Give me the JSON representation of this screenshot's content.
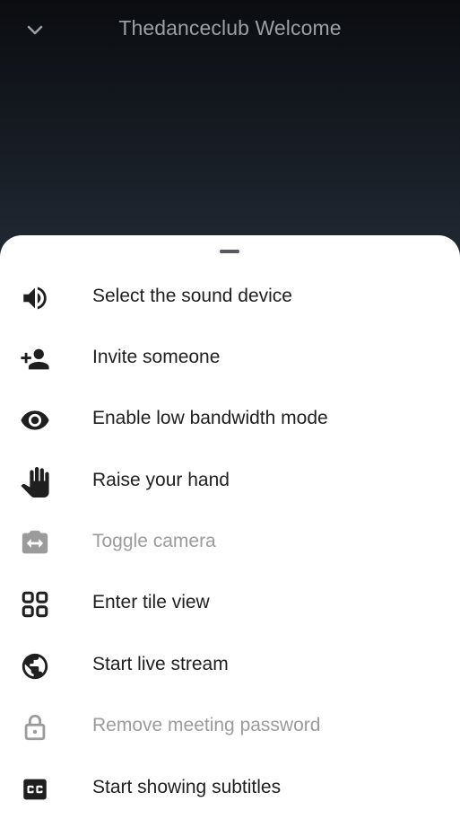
{
  "header": {
    "title": "Thedanceclub Welcome",
    "collapse_icon": "chevron-down-icon"
  },
  "colors": {
    "title": "#9aa0a6",
    "enabled": "#1f1f1f",
    "disabled": "#9b9b9b",
    "sheet_background": "#ffffff"
  },
  "menu": {
    "items": [
      {
        "label": "Select the sound device",
        "icon": "speaker-icon",
        "enabled": true
      },
      {
        "label": "Invite someone",
        "icon": "person-add-icon",
        "enabled": true
      },
      {
        "label": "Enable low bandwidth mode",
        "icon": "eye-icon",
        "enabled": true
      },
      {
        "label": "Raise your hand",
        "icon": "hand-icon",
        "enabled": true
      },
      {
        "label": "Toggle camera",
        "icon": "switch-camera-icon",
        "enabled": false
      },
      {
        "label": "Enter tile view",
        "icon": "tile-view-icon",
        "enabled": true
      },
      {
        "label": "Start live stream",
        "icon": "globe-icon",
        "enabled": true
      },
      {
        "label": "Remove meeting password",
        "icon": "lock-icon",
        "enabled": false
      },
      {
        "label": "Start showing subtitles",
        "icon": "closed-captions-icon",
        "enabled": true
      }
    ]
  }
}
